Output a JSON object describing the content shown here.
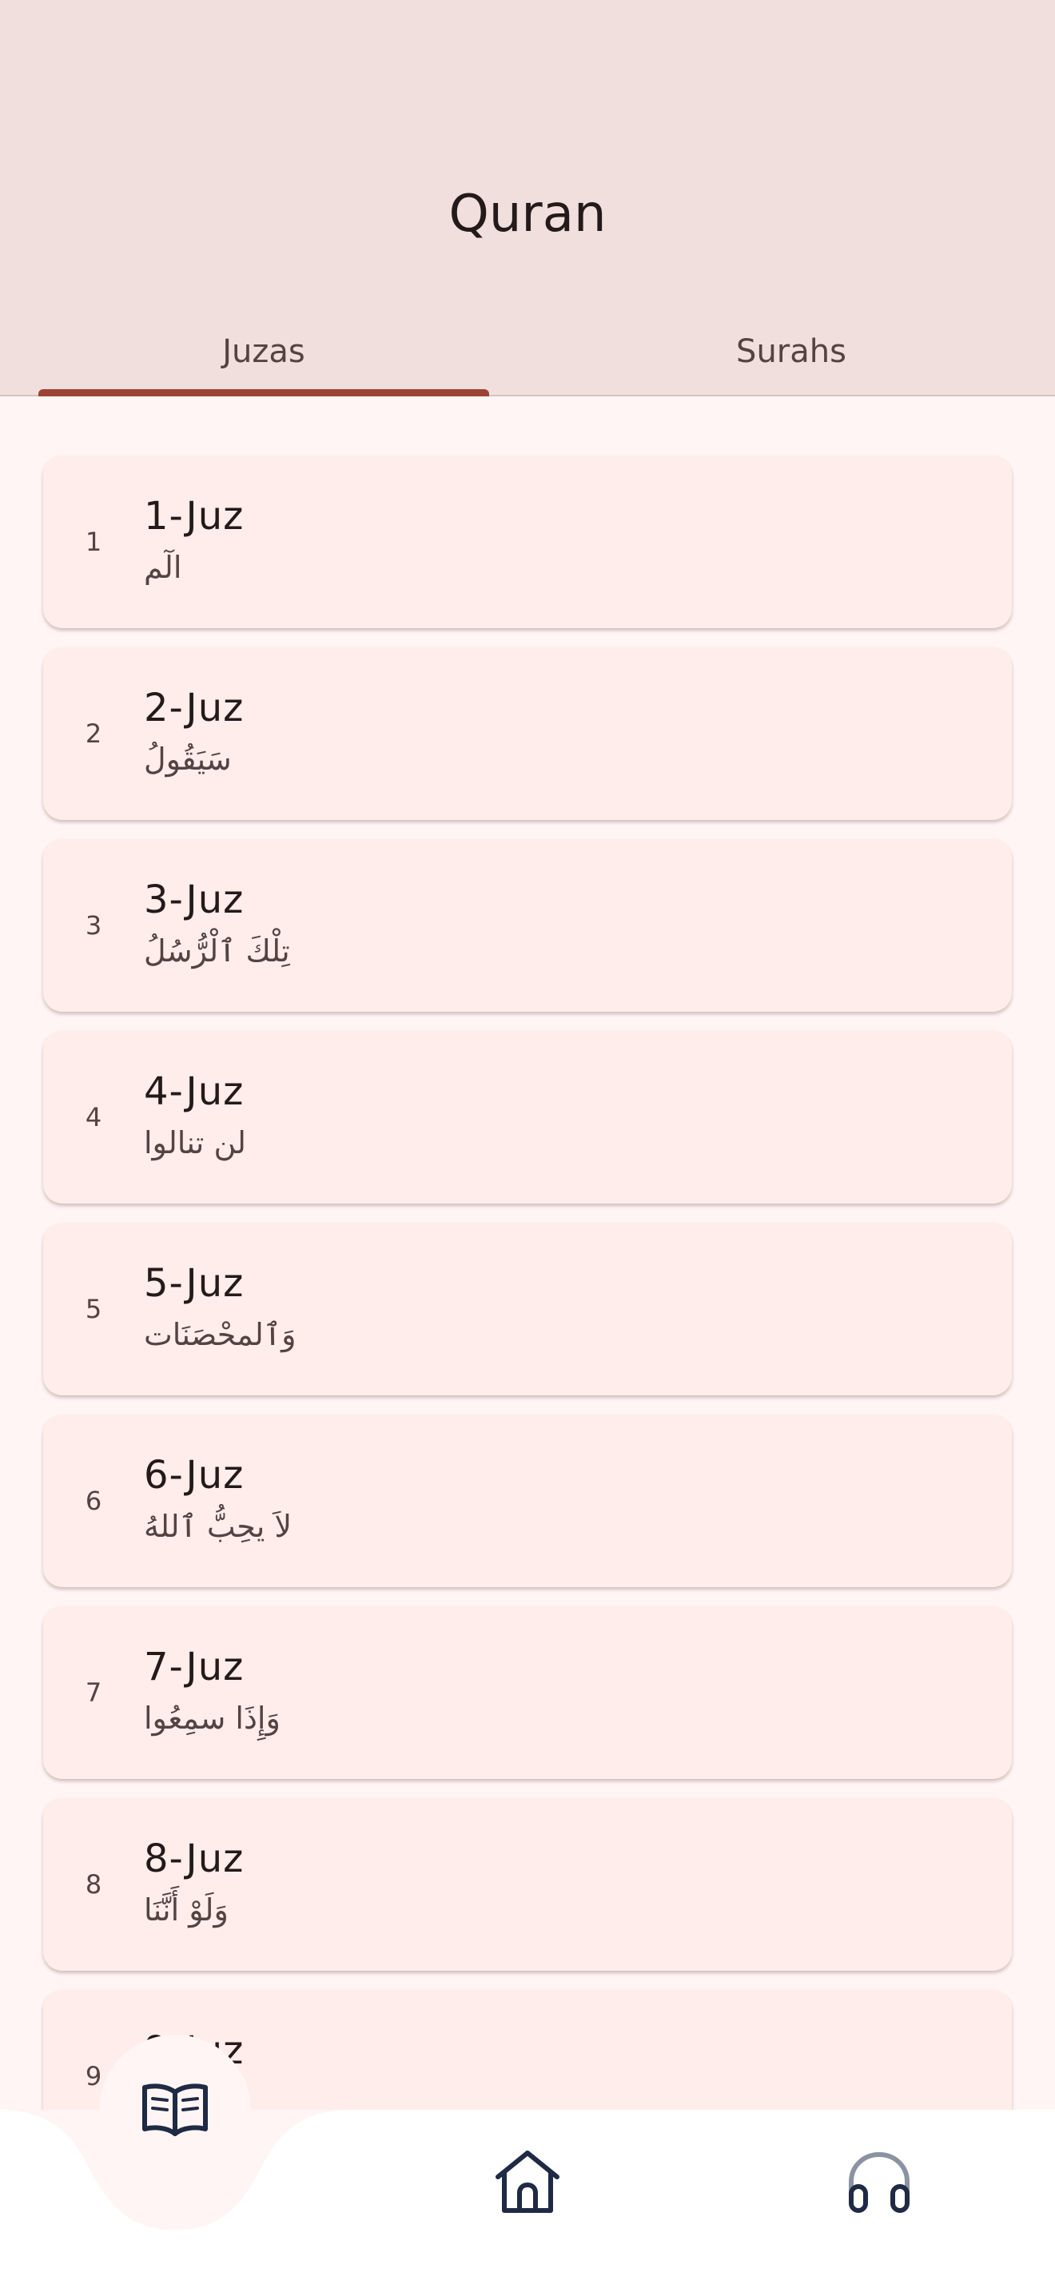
{
  "app_bar": {
    "title": "Quran"
  },
  "tabs": [
    {
      "label": "Juzas",
      "selected": true
    },
    {
      "label": "Surahs",
      "selected": false
    }
  ],
  "juz_list": [
    {
      "number": "1",
      "title": "1-Juz",
      "arabic": "الٓم"
    },
    {
      "number": "2",
      "title": "2-Juz",
      "arabic": "سَيَقُولُ"
    },
    {
      "number": "3",
      "title": "3-Juz",
      "arabic": "تِلْكَ ٱلْرُّسُلُ"
    },
    {
      "number": "4",
      "title": "4-Juz",
      "arabic": "لن تنالوا"
    },
    {
      "number": "5",
      "title": "5-Juz",
      "arabic": "وَٱلمحْصَنَات"
    },
    {
      "number": "6",
      "title": "6-Juz",
      "arabic": "لاَ يحِبُّ ٱللهُ"
    },
    {
      "number": "7",
      "title": "7-Juz",
      "arabic": "وَإِذَا سمِعُوا"
    },
    {
      "number": "8",
      "title": "8-Juz",
      "arabic": "وَلَوْ أَنَّنَا"
    },
    {
      "number": "9",
      "title": "9-Juz",
      "arabic": ""
    }
  ],
  "bottom_nav": {
    "items": [
      {
        "icon": "book-open-icon",
        "active": true
      },
      {
        "icon": "home-icon",
        "active": false
      },
      {
        "icon": "headphones-icon",
        "active": false
      }
    ]
  },
  "colors": {
    "header_bg": "#f0dfdd",
    "page_bg": "#fff5f4",
    "card_bg": "#ffedeb",
    "accent": "#9a4336",
    "icon_dark": "#1f2a44"
  }
}
